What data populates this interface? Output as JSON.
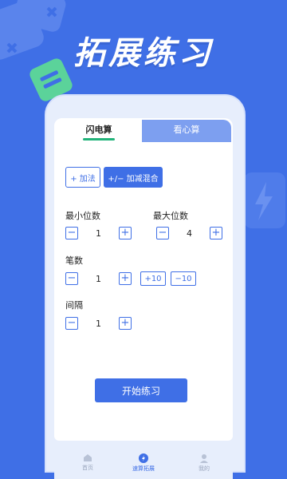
{
  "header": {
    "title": "拓展练习"
  },
  "tabs": [
    {
      "label": "闪电算",
      "active": true
    },
    {
      "label": "看心算",
      "active": false
    }
  ],
  "modes": {
    "plus_label": "+ 加法",
    "mix_label": "+/− 加减混合"
  },
  "min_digits": {
    "label": "最小位数",
    "value": "1"
  },
  "max_digits": {
    "label": "最大位数",
    "value": "4"
  },
  "strokes": {
    "label": "笔数",
    "value": "1",
    "plus10": "+10",
    "minus10": "−10"
  },
  "interval": {
    "label": "间隔",
    "value": "1"
  },
  "stepper": {
    "minus": "−",
    "plus": "+"
  },
  "start_button": "开始练习",
  "bottom_nav": {
    "home": "首页",
    "speed": "速算拓展",
    "mine": "我的"
  },
  "colors": {
    "accent": "#3f6fe6",
    "tab_underline": "#22b37a",
    "inactive_tab": "#7d9ff0"
  }
}
